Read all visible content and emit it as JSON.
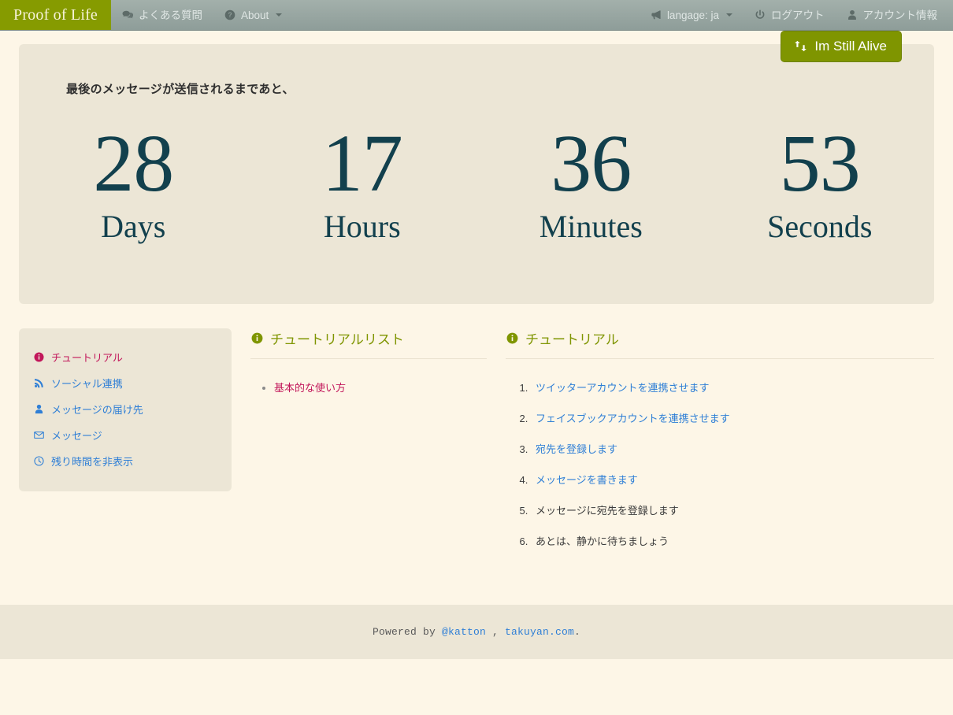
{
  "navbar": {
    "brand": "Proof of Life",
    "left_items": [
      {
        "label": "よくある質問",
        "icon": "comment-icon",
        "caret": false
      },
      {
        "label": "About",
        "icon": "question-circle-icon",
        "caret": true
      }
    ],
    "right_items": [
      {
        "label": "langage: ja",
        "icon": "bullhorn-icon",
        "caret": true
      },
      {
        "label": "ログアウト",
        "icon": "power-off-icon",
        "caret": false
      },
      {
        "label": "アカウント情報",
        "icon": "user-icon",
        "caret": false
      }
    ]
  },
  "hero": {
    "alive_button": {
      "label": "Im Still Alive",
      "icon": "retweet-icon"
    },
    "title": "最後のメッセージが送信されるまであと、",
    "counters": [
      {
        "value": "28",
        "label": "Days"
      },
      {
        "value": "17",
        "label": "Hours"
      },
      {
        "value": "36",
        "label": "Minutes"
      },
      {
        "value": "53",
        "label": "Seconds"
      }
    ]
  },
  "sidebar": {
    "items": [
      {
        "label": "チュートリアル",
        "icon": "info-circle-icon",
        "active": true
      },
      {
        "label": "ソーシャル連携",
        "icon": "rss-icon",
        "active": false
      },
      {
        "label": "メッセージの届け先",
        "icon": "user-icon",
        "active": false
      },
      {
        "label": "メッセージ",
        "icon": "envelope-icon",
        "active": false
      },
      {
        "label": "残り時間を非表示",
        "icon": "clock-icon",
        "active": false
      }
    ]
  },
  "tutorial_list": {
    "heading": "チュートリアルリスト",
    "heading_icon": "info-circle-icon",
    "items": [
      {
        "label": "基本的な使い方",
        "link": true
      }
    ]
  },
  "tutorial": {
    "heading": "チュートリアル",
    "heading_icon": "info-circle-icon",
    "steps": [
      {
        "label": "ツイッターアカウントを連携させます",
        "link": true
      },
      {
        "label": "フェイスブックアカウントを連携させます",
        "link": true
      },
      {
        "label": "宛先を登録します",
        "link": true
      },
      {
        "label": "メッセージを書きます",
        "link": true
      },
      {
        "label": "メッセージに宛先を登録します",
        "link": false
      },
      {
        "label": "あとは、静かに待ちましょう",
        "link": false
      }
    ]
  },
  "footer": {
    "prefix": "Powered by ",
    "link1": "@katton",
    "separator": " , ",
    "link2": "takuyan.com",
    "suffix": "."
  },
  "colors": {
    "brand_olive": "#869b00",
    "navbar_top": "#a3b0ab",
    "navbar_bottom": "#8e9d99",
    "page_bg": "#fdf6e7",
    "panel_bg": "#ece6d6",
    "counter_teal": "#12404d",
    "link_blue": "#2f7fd6",
    "active_pink": "#c2185b",
    "heading_olive": "#7f9500",
    "alive_button": "#7f9500"
  }
}
